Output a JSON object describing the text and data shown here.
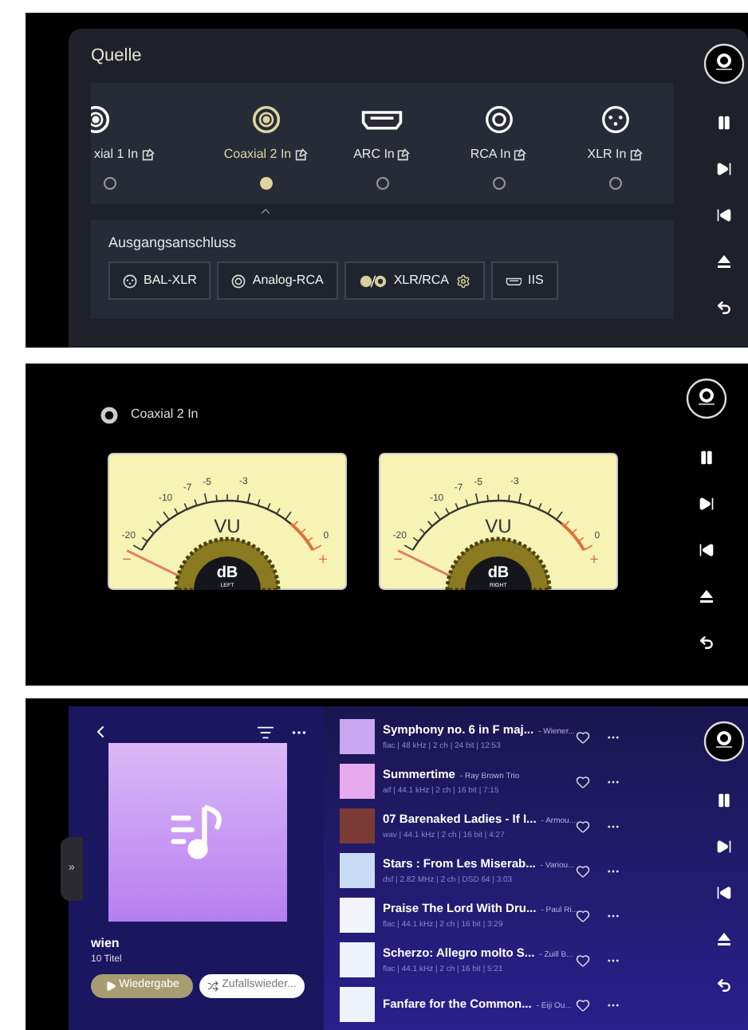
{
  "source_screen": {
    "title": "Quelle",
    "inputs": [
      {
        "label": "xial 1 In",
        "kind": "coaxial",
        "selected": false
      },
      {
        "label": "Coaxial 2 In",
        "kind": "coaxial",
        "selected": true
      },
      {
        "label": "ARC In",
        "kind": "hdmi",
        "selected": false
      },
      {
        "label": "RCA In",
        "kind": "rca",
        "selected": false
      },
      {
        "label": "XLR In",
        "kind": "xlr",
        "selected": false
      }
    ],
    "output_title": "Ausgangsanschluss",
    "outputs": [
      {
        "label": "BAL-XLR",
        "kind": "xlr"
      },
      {
        "label": "Analog-RCA",
        "kind": "rca"
      },
      {
        "label": "XLR/RCA",
        "kind": "combo"
      },
      {
        "label": "IIS",
        "kind": "hdmi"
      }
    ]
  },
  "meter_screen": {
    "source": "Coaxial 2 In",
    "meters": [
      {
        "scale": [
          "-20",
          "-10",
          "-7",
          "-5",
          "-3",
          "0"
        ],
        "unit": "VU",
        "db": "dB",
        "channel": "LEFT",
        "minus": "−",
        "plus": "+"
      },
      {
        "scale": [
          "-20",
          "-10",
          "-7",
          "-5",
          "-3",
          "0"
        ],
        "unit": "VU",
        "db": "dB",
        "channel": "RIGHT",
        "minus": "−",
        "plus": "+"
      }
    ]
  },
  "playlist_screen": {
    "side_tab": "»",
    "name": "wien",
    "count": "10 Titel",
    "play_button": "Wiedergabe",
    "shuffle_button": "Zufallswieder...",
    "tracks": [
      {
        "title": "Symphony no. 6 in F maj...",
        "artist": "- Wiener...",
        "meta": "flac | 48 kHz | 2 ch | 24 bit | 12:53",
        "color": "#c9a6f0"
      },
      {
        "title": "Summertime",
        "artist": "- Ray Brown Trio",
        "meta": "aif | 44.1 kHz | 2 ch | 16 bit | 7:15",
        "color": "#e7a9ee"
      },
      {
        "title": "07 Barenaked Ladies - If I...",
        "artist": "- Armou...",
        "meta": "wav | 44.1 kHz | 2 ch | 16 bit | 4:27",
        "color": "#7a3a36"
      },
      {
        "title": "Stars : From Les Miserab...",
        "artist": "- Variou...",
        "meta": "dsf | 2.82 MHz | 2 ch | DSD 64 | 3:03",
        "color": "#c8dcf5"
      },
      {
        "title": "Praise The Lord With Dru...",
        "artist": "- Paul Ri...",
        "meta": "flac | 44.1 kHz | 2 ch | 16 bit | 3:29",
        "color": "#f2f4fa"
      },
      {
        "title": "Scherzo: Allegro molto S...",
        "artist": "- Zuill B...",
        "meta": "flac | 44.1 kHz | 2 ch | 16 bit | 5:21",
        "color": "#eef2fb"
      },
      {
        "title": "Fanfare for the Common...",
        "artist": "- Eiji Ou...",
        "color": "#eef2fb"
      }
    ]
  }
}
